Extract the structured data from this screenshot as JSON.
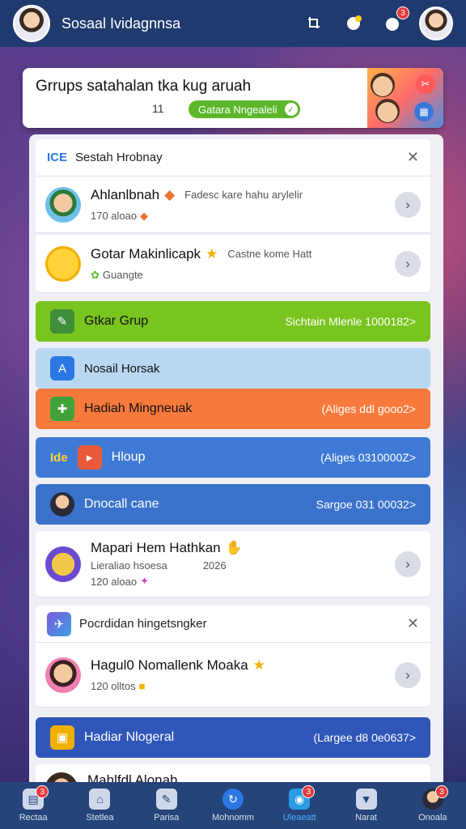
{
  "header": {
    "title": "Sosaal Ividagnnsa",
    "icons": [
      "crop-icon",
      "chat-icon",
      "notification-icon"
    ],
    "notification_badge": "3"
  },
  "banner": {
    "title": "Grrups satahalan tka kug aruah",
    "count": "11",
    "pill_label": "Gatara Nngealeli"
  },
  "section1": {
    "title": "Sestah Hrobnay",
    "icon_text": "ICE"
  },
  "card1": {
    "name": "Ahlanlbnah",
    "sub": "Fadesc kare hahu arylelir",
    "meta": "170 aloao"
  },
  "card2": {
    "name": "Gotar Makinlicapk",
    "sub": "Castne kome Hatt",
    "meta": "Guangte"
  },
  "bar_green": {
    "label": "Gtkar Grup",
    "right": "Sichtain Mlenle 1000182>"
  },
  "bar_light": {
    "label": "Nosail Horsak"
  },
  "bar_orange": {
    "label": "Hadiah Mingneuak",
    "right": "(Aliges ddl gooo2>"
  },
  "bar_blue1": {
    "label": "Hloup",
    "right": "(Aliges 0310000Z>",
    "icon_text": "Ide"
  },
  "bar_blue2": {
    "label": "Dnocall cane",
    "right": "Sargoe 031 00032>"
  },
  "card3": {
    "name": "Mapari Hem Hathkan",
    "sub_line": "Lieraliao hsoesa",
    "year": "2026",
    "meta": "120 aloao"
  },
  "section2": {
    "title": "Pocrdidan hingetsngker"
  },
  "card4": {
    "name": "Hagul0 Nomallenk Moaka",
    "meta": "120 olltos"
  },
  "bar_navy": {
    "label": "Hadiar Nlogeral",
    "right": "(Largee d8 0e0637>"
  },
  "card5": {
    "name": "Mahlfdl Alonah"
  },
  "bottom_nav": [
    {
      "label": "Rectaa",
      "badge": "3"
    },
    {
      "label": "Stetlea"
    },
    {
      "label": "Parisa"
    },
    {
      "label": "Mohnomm"
    },
    {
      "label": "Uleaeatt",
      "badge": "3"
    },
    {
      "label": "Narat"
    },
    {
      "label": "Onoala",
      "badge": "3"
    }
  ],
  "colors": {
    "topbar": "#1f3a6e",
    "green": "#7ac41f",
    "light_blue": "#b9d7f0",
    "orange": "#f77a3c",
    "blue": "#3f7bd6",
    "navy": "#2f56b8"
  }
}
